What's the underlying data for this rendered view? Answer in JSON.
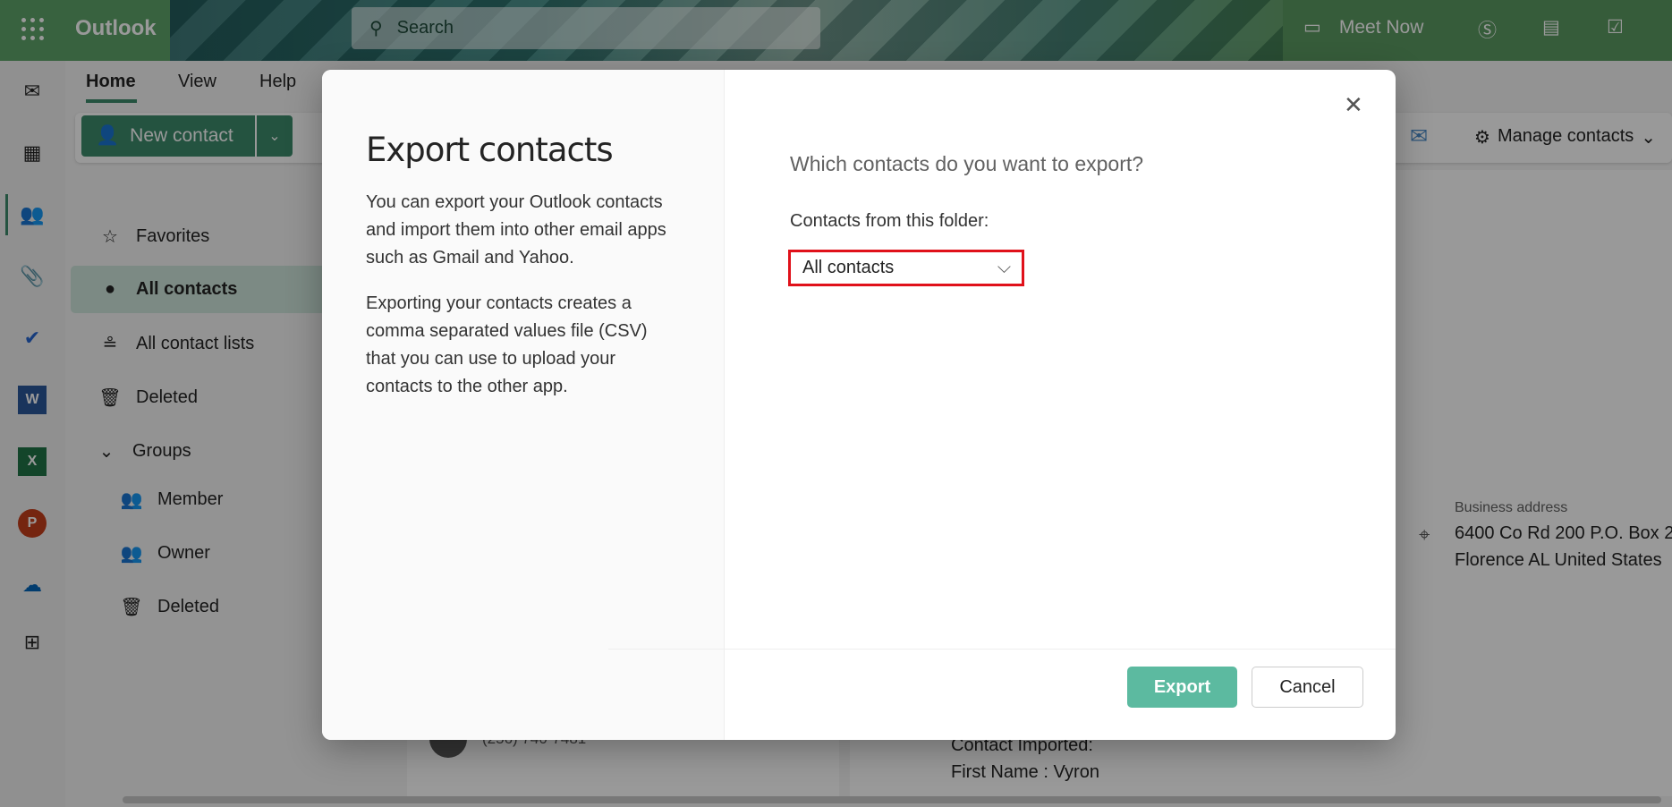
{
  "app": {
    "name": "Outlook",
    "search_placeholder": "Search",
    "meet_now": "Meet Now"
  },
  "tabs": [
    {
      "label": "Home",
      "active": true
    },
    {
      "label": "View"
    },
    {
      "label": "Help"
    }
  ],
  "ribbon": {
    "new_contact": "New contact",
    "manage_contacts": "Manage contacts"
  },
  "rail": [
    "mail-icon",
    "calendar-icon",
    "people-icon",
    "attach-icon",
    "todo-icon",
    "word-icon",
    "excel-icon",
    "powerpoint-icon",
    "onedrive-icon",
    "apps-icon"
  ],
  "nav": {
    "favorites": "Favorites",
    "all_contacts": "All contacts",
    "all_contact_lists": "All contact lists",
    "deleted": "Deleted",
    "groups": "Groups",
    "member": "Member",
    "owner": "Owner",
    "groups_deleted": "Deleted"
  },
  "background": {
    "phone": "(256) 740-7481",
    "contact_imported": "Contact Imported:",
    "first_name": "First Name : Vyron",
    "business_address_label": "Business address",
    "address_line1": "6400 Co Rd 200 P.O. Box 2",
    "address_line2": "Florence AL United States"
  },
  "dialog": {
    "title": "Export contacts",
    "para1": "You can export your Outlook contacts and import them into other email apps such as Gmail and Yahoo.",
    "para2": "Exporting your contacts creates a comma separated values file (CSV) that you can use to upload your contacts to the other app.",
    "question": "Which contacts do you want to export?",
    "folder_label": "Contacts from this folder:",
    "folder_value": "All contacts",
    "export": "Export",
    "cancel": "Cancel"
  },
  "colors": {
    "accent": "#3d8a6c",
    "export_button": "#5cbaa0",
    "highlight": "#e0111a"
  }
}
